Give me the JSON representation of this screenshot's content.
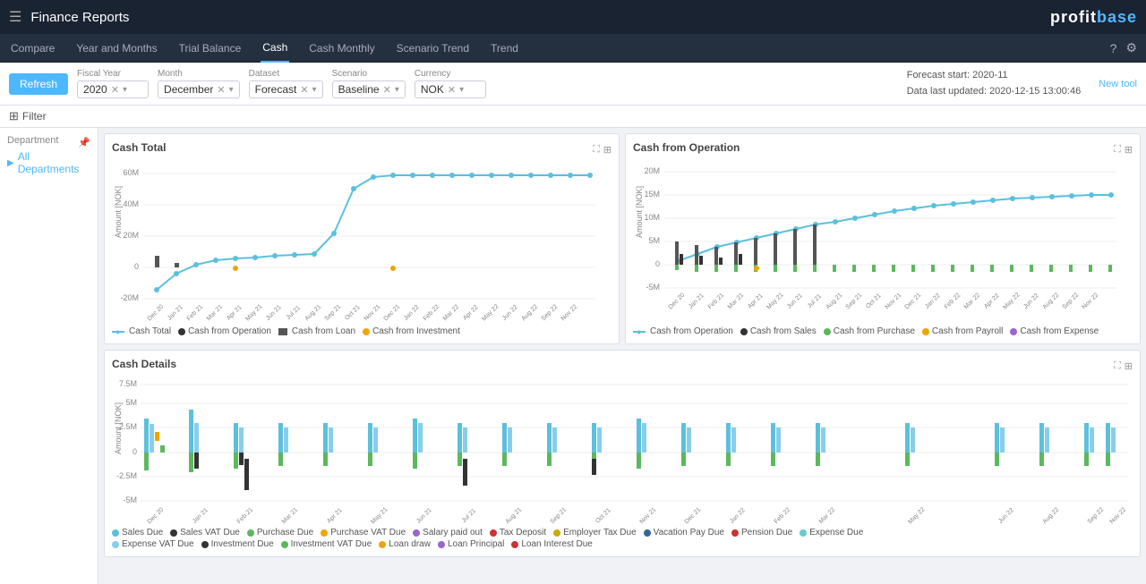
{
  "topbar": {
    "hamburger": "☰",
    "title": "Finance Reports",
    "logo": "profitbase"
  },
  "navbar": {
    "items": [
      "Compare",
      "Year and Months",
      "Trial Balance",
      "Cash",
      "Cash Monthly",
      "Scenario Trend",
      "Trend"
    ],
    "active": "Cash"
  },
  "icons": {
    "help": "?",
    "settings": "⚙",
    "pin": "📌",
    "filter": "⊞",
    "filter_label": "Filter"
  },
  "filterbar": {
    "refresh_label": "Refresh",
    "filter_label": "Filter",
    "fiscal_year_label": "Fiscal Year",
    "fiscal_year_value": "2020",
    "month_label": "Month",
    "month_value": "December",
    "dataset_label": "Dataset",
    "dataset_value": "Forecast",
    "scenario_label": "Scenario",
    "scenario_value": "Baseline",
    "currency_label": "Currency",
    "currency_value": "NOK",
    "forecast_start": "Forecast start: 2020-11",
    "data_last_updated": "Data last updated: 2020-12-15 13:00:46",
    "new_tool": "New tool"
  },
  "sidebar": {
    "title": "Department",
    "items": [
      "All Departments"
    ]
  },
  "charts": {
    "cash_total": {
      "title": "Cash Total",
      "y_labels": [
        "60M",
        "40M",
        "20M",
        "0",
        "-20M"
      ],
      "x_labels": [
        "Dec 20",
        "Jan 21",
        "Feb 21",
        "Mar 21",
        "Apr 21",
        "May 21",
        "Jun 21",
        "Jul 21",
        "Aug 21",
        "Sep 21",
        "Oct 21",
        "Nov 21",
        "Dec 21",
        "Jan 22",
        "Feb 22",
        "Mar 22",
        "Apr 22",
        "May 22",
        "Jun 22",
        "Aug 22",
        "Sep 22",
        "Nov 22"
      ],
      "legend": [
        {
          "label": "Cash Total",
          "color": "#5bc0de",
          "type": "line"
        },
        {
          "label": "Cash from Operation",
          "color": "#333",
          "type": "dot"
        },
        {
          "label": "Cash from Loan",
          "color": "#333",
          "type": "bar"
        },
        {
          "label": "Cash from Investment",
          "color": "#f0a500",
          "type": "dot"
        }
      ]
    },
    "cash_from_operation": {
      "title": "Cash from Operation",
      "y_labels": [
        "20M",
        "15M",
        "10M",
        "5M",
        "0",
        "-5M"
      ],
      "legend": [
        {
          "label": "Cash from Operation",
          "color": "#5bc0de",
          "type": "line"
        },
        {
          "label": "Cash from Sales",
          "color": "#333",
          "type": "bar"
        },
        {
          "label": "Cash from Purchase",
          "color": "#333",
          "type": "bar"
        },
        {
          "label": "Cash from Payroll",
          "color": "#f0a500",
          "type": "bar"
        },
        {
          "label": "Cash from Expense",
          "color": "#9966cc",
          "type": "bar"
        }
      ]
    },
    "cash_details": {
      "title": "Cash Details",
      "y_labels": [
        "7.5M",
        "5M",
        "2.5M",
        "0",
        "-2.5M",
        "-5M"
      ],
      "x_labels": [
        "Dec 20",
        "Jan 21",
        "Feb 21",
        "Mar 21",
        "Apr 21",
        "May 21",
        "Jun 21",
        "Jul 21",
        "Aug 21",
        "Sep 21",
        "Oct 21",
        "Nov 21",
        "Dec 21",
        "Jan 22",
        "Feb 22",
        "Mar 22",
        "May 22",
        "Jun 22",
        "Aug 22",
        "Sep 22",
        "Nov 22"
      ],
      "legend_row1": [
        {
          "label": "Sales Due",
          "color": "#5bc0de"
        },
        {
          "label": "Sales VAT Due",
          "color": "#333"
        },
        {
          "label": "Purchase Due",
          "color": "#5cb85c"
        },
        {
          "label": "Purchase VAT Due",
          "color": "#f0a500"
        },
        {
          "label": "Salary paid out",
          "color": "#9966cc"
        },
        {
          "label": "Tax Deposit",
          "color": "#cc3333"
        },
        {
          "label": "Employer Tax Due",
          "color": "#ccaa00"
        },
        {
          "label": "Vacation Pay Due",
          "color": "#336699"
        },
        {
          "label": "Pension Due",
          "color": "#cc3333"
        },
        {
          "label": "Expense Due",
          "color": "#66cccc"
        }
      ],
      "legend_row2": [
        {
          "label": "Expense VAT Due",
          "color": "#5bc0de"
        },
        {
          "label": "Investment Due",
          "color": "#333"
        },
        {
          "label": "Investment VAT Due",
          "color": "#5cb85c"
        },
        {
          "label": "Loan draw",
          "color": "#f0a500"
        },
        {
          "label": "Loan Principal",
          "color": "#9966cc"
        },
        {
          "label": "Loan Interest Due",
          "color": "#cc3333"
        }
      ]
    }
  }
}
